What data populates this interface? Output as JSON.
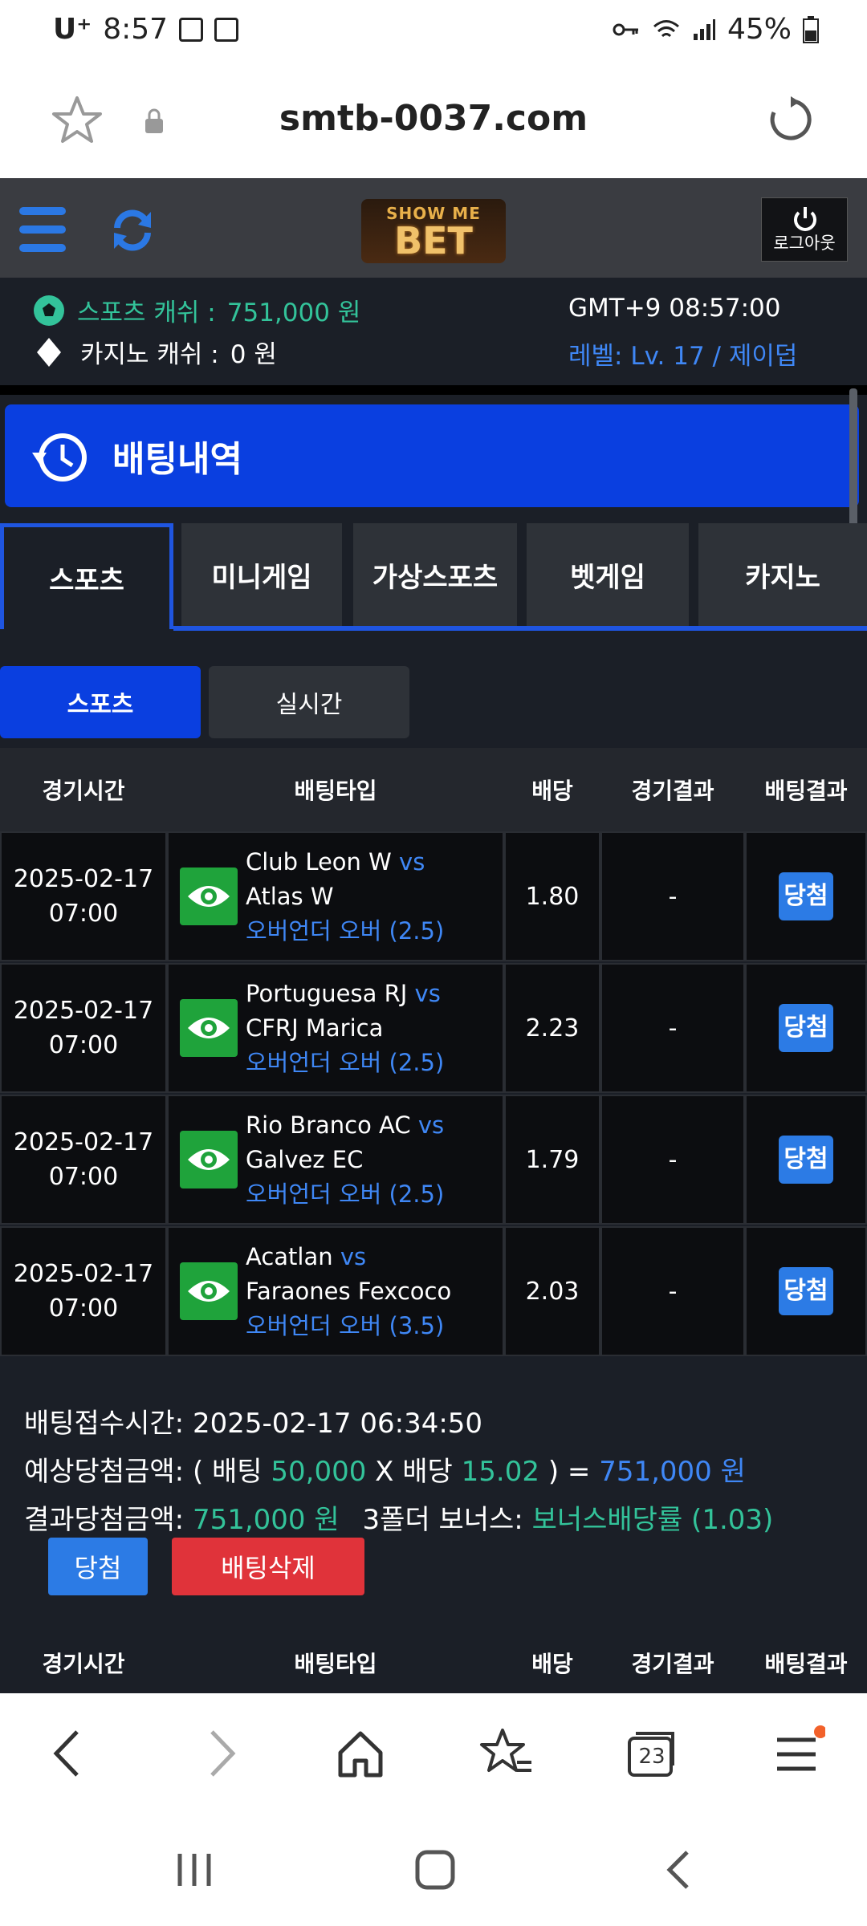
{
  "status_bar": {
    "carrier": "U⁺",
    "time": "8:57",
    "battery": "45%"
  },
  "browser": {
    "url": "smtb-0037.com"
  },
  "header": {
    "logo_top": "SHOW ME",
    "logo_main": "BET",
    "logout_label": "로그아웃"
  },
  "user": {
    "sports_cash_label": "스포츠 캐쉬 :",
    "sports_cash_value": "751,000 원",
    "casino_cash_label": "카지노 캐쉬 :",
    "casino_cash_value": "0 원",
    "server_time": "GMT+9 08:57:00",
    "level": "레벨: Lv. 17 / 제이덥"
  },
  "page_title": "배팅내역",
  "tabs": [
    "스포츠",
    "미니게임",
    "가상스포츠",
    "벳게임",
    "카지노"
  ],
  "subtabs": [
    "스포츠",
    "실시간"
  ],
  "table_headers": [
    "경기시간",
    "배팅타입",
    "배당",
    "경기결과",
    "배팅결과"
  ],
  "rows": [
    {
      "date": "2025-02-17",
      "time": "07:00",
      "home": "Club Leon W",
      "vs": "vs",
      "away": "Atlas W",
      "market": "오버언더 오버 (2.5)",
      "odds": "1.80",
      "result": "-",
      "status": "당첨"
    },
    {
      "date": "2025-02-17",
      "time": "07:00",
      "home": "Portuguesa RJ",
      "vs": "vs",
      "away": "CFRJ Marica",
      "market": "오버언더 오버 (2.5)",
      "odds": "2.23",
      "result": "-",
      "status": "당첨"
    },
    {
      "date": "2025-02-17",
      "time": "07:00",
      "home": "Rio Branco AC",
      "vs": "vs",
      "away": "Galvez EC",
      "market": "오버언더 오버 (2.5)",
      "odds": "1.79",
      "result": "-",
      "status": "당첨"
    },
    {
      "date": "2025-02-17",
      "time": "07:00",
      "home": "Acatlan",
      "vs": "vs",
      "away": "Faraones Fexcoco",
      "market": "오버언더 오버 (3.5)",
      "odds": "2.03",
      "result": "-",
      "status": "당첨"
    }
  ],
  "summary": {
    "accept_label": "배팅접수시간:",
    "accept_time": "2025-02-17 06:34:50",
    "expected_label": "예상당첨금액: ( 배팅",
    "bet_amount": "50,000",
    "x_label": "X 배당",
    "total_odds": "15.02",
    "eq_label": ") =",
    "expected_value": "751,000 원",
    "result_label": "결과당첨금액:",
    "result_value": "751,000 원",
    "bonus_label": "3폴더 보너스:",
    "bonus_value": "보너스배당률 (1.03)",
    "win_button": "당첨",
    "delete_button": "배팅삭제"
  },
  "browser_nav": {
    "tab_count": "23"
  }
}
